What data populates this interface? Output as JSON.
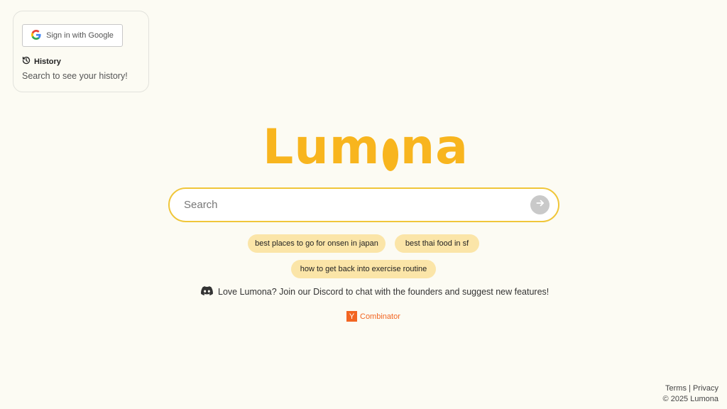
{
  "sidebar": {
    "google_signin_label": "Sign in with Google",
    "history_title": "History",
    "history_empty_text": "Search to see your history!"
  },
  "logo": {
    "part1": "Lum",
    "part2": "na"
  },
  "search": {
    "placeholder": "Search",
    "value": ""
  },
  "suggestions": [
    "best places to go for onsen in japan",
    "best thai food in sf",
    "how to get back into exercise routine"
  ],
  "discord": {
    "text": "Love Lumona? Join our Discord to chat with the founders and suggest new features!"
  },
  "yc": {
    "letter": "Y",
    "label": "Combinator"
  },
  "footer": {
    "terms": "Terms",
    "separator": "|",
    "privacy": "Privacy",
    "copyright": "© 2025 Lumona"
  },
  "colors": {
    "background": "#fcfbf3",
    "brand": "#f8b51e",
    "chip": "#fbe5a8",
    "search_border": "#f0c63a",
    "yc_orange": "#f26522"
  },
  "icons": {
    "google": "google-icon",
    "history": "history-icon",
    "submit": "arrow-right-icon",
    "discord": "discord-icon"
  }
}
